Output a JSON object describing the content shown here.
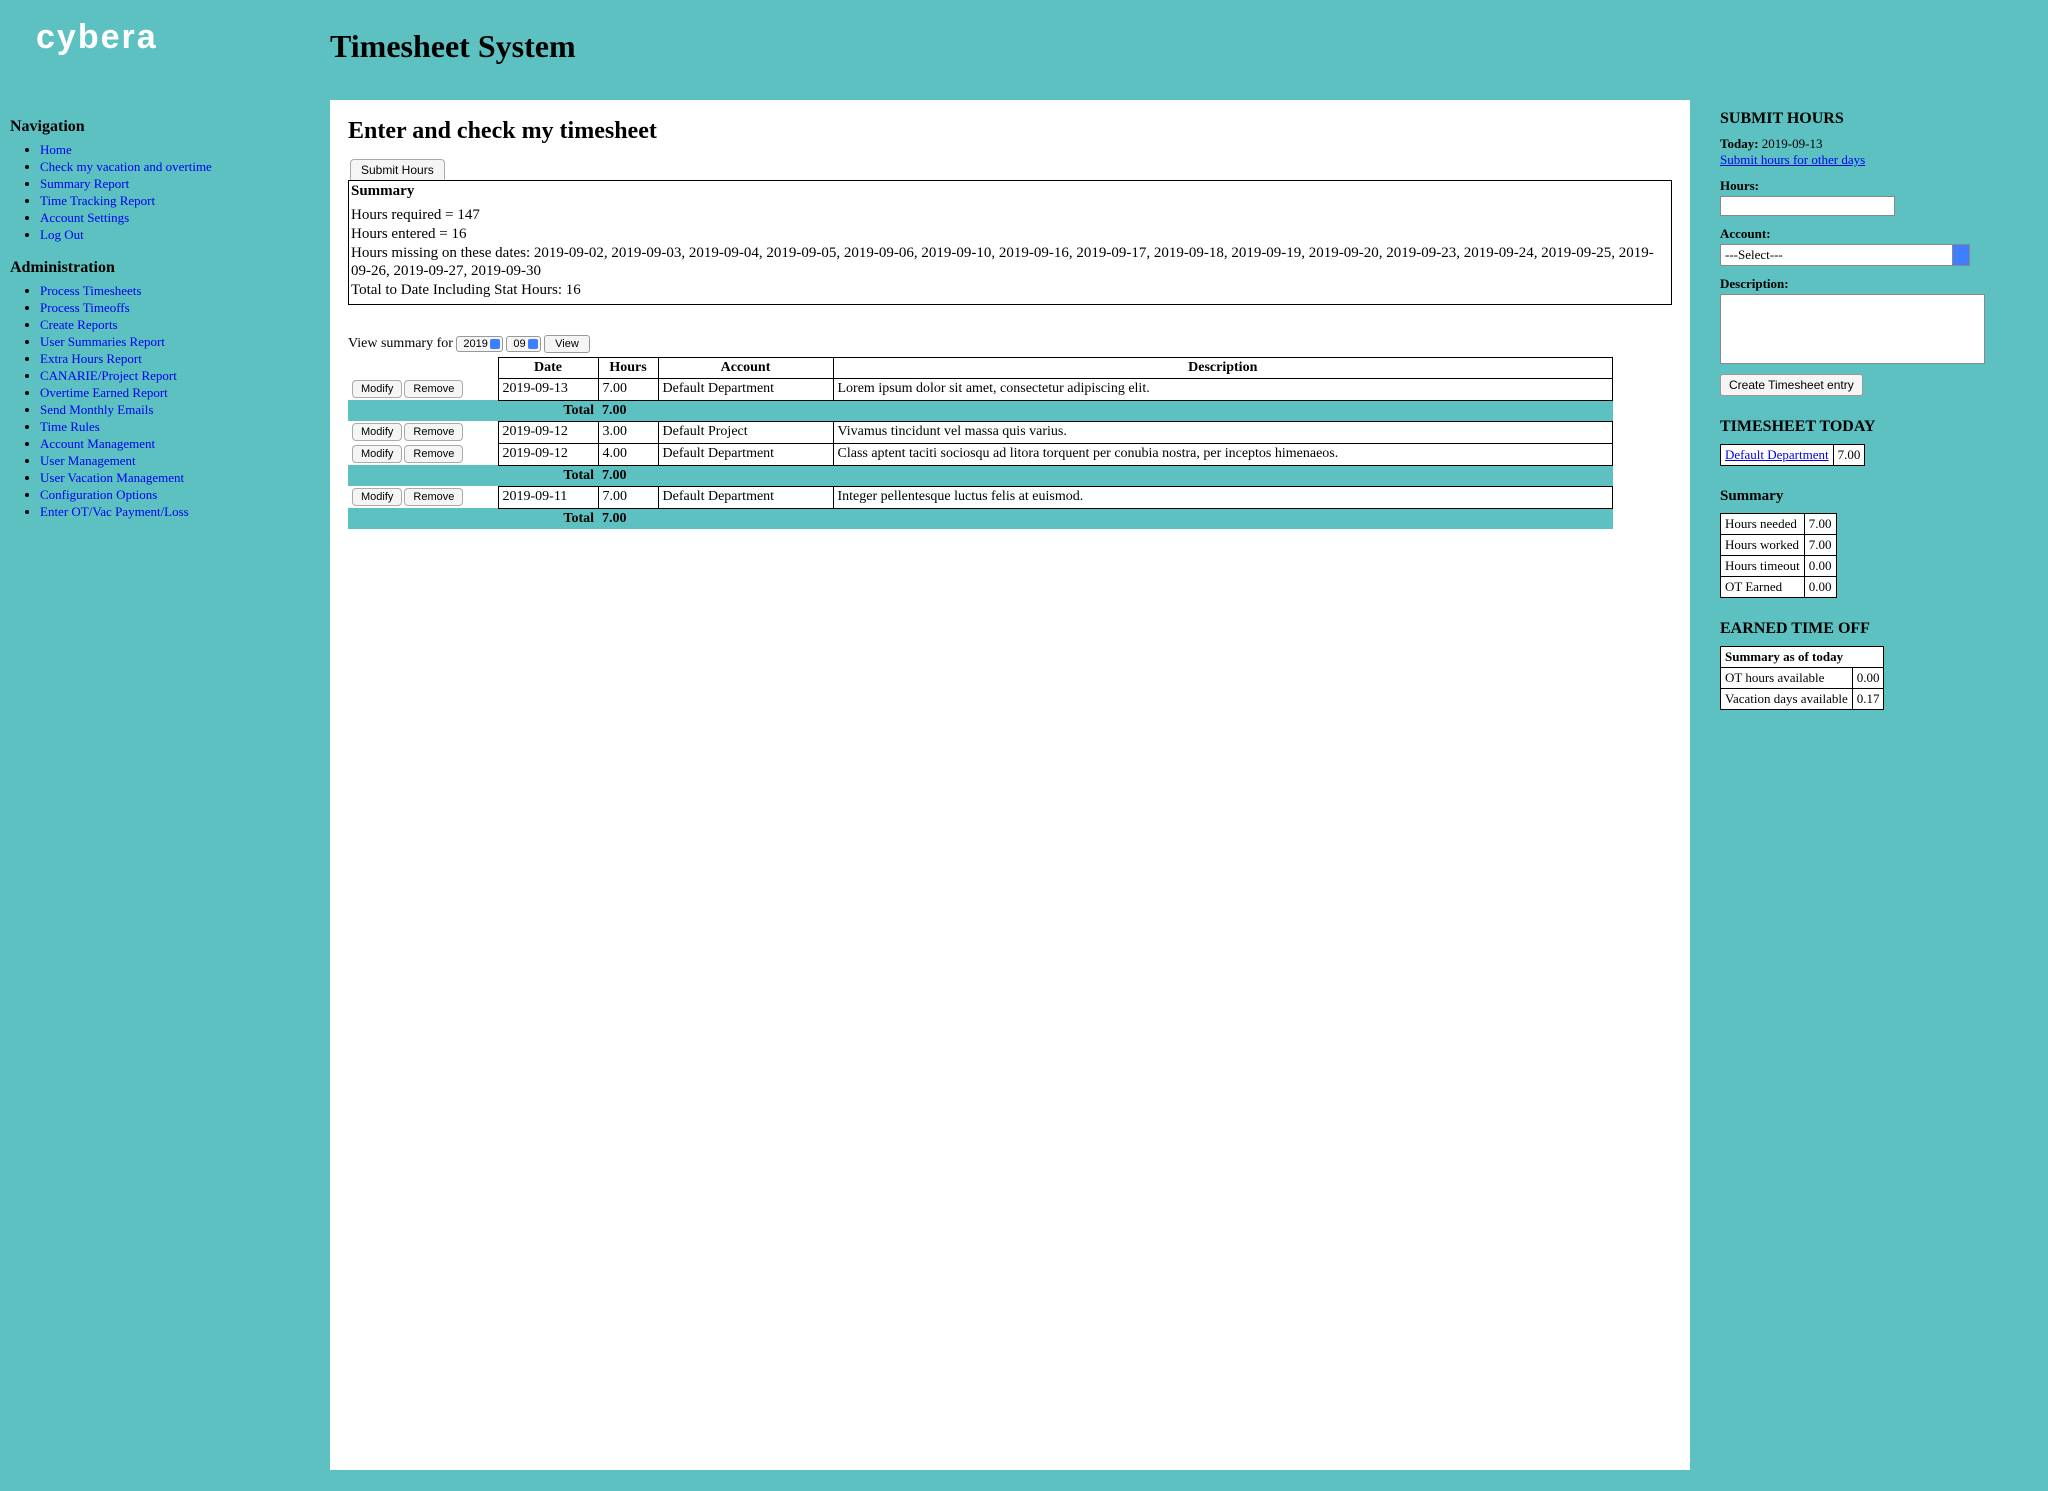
{
  "brand": "cybera",
  "app_title": "Timesheet System",
  "nav": {
    "heading": "Navigation",
    "items": [
      "Home",
      "Check my vacation and overtime",
      "Summary Report",
      "Time Tracking Report",
      "Account Settings",
      "Log Out"
    ]
  },
  "admin": {
    "heading": "Administration",
    "items": [
      "Process Timesheets",
      "Process Timeoffs",
      "Create Reports",
      "User Summaries Report",
      "Extra Hours Report",
      "CANARIE/Project Report",
      "Overtime Earned Report",
      "Send Monthly Emails",
      "Time Rules",
      "Account Management",
      "User Management",
      "User Vacation Management",
      "Configuration Options",
      "Enter OT/Vac Payment/Loss"
    ]
  },
  "main": {
    "heading": "Enter and check my timesheet",
    "tab_submit": "Submit Hours",
    "summary": {
      "title": "Summary",
      "required": "Hours required = 147",
      "entered": "Hours entered = 16",
      "missing": "Hours missing on these dates: 2019-09-02, 2019-09-03, 2019-09-04, 2019-09-05, 2019-09-06, 2019-09-10, 2019-09-16, 2019-09-17, 2019-09-18, 2019-09-19, 2019-09-20, 2019-09-23, 2019-09-24, 2019-09-25, 2019-09-26, 2019-09-27, 2019-09-30",
      "total": "Total to Date Including Stat Hours: 16"
    },
    "view_label": "View summary for",
    "year": "2019",
    "month": "09",
    "view_btn": "View",
    "modify_label": "Modify",
    "remove_label": "Remove",
    "cols": {
      "date": "Date",
      "hours": "Hours",
      "account": "Account",
      "description": "Description"
    },
    "total_label": "Total",
    "groups": [
      {
        "rows": [
          {
            "date": "2019-09-13",
            "hours": "7.00",
            "account": "Default Department",
            "desc": "Lorem ipsum dolor sit amet, consectetur adipiscing elit."
          }
        ],
        "total": "7.00"
      },
      {
        "rows": [
          {
            "date": "2019-09-12",
            "hours": "3.00",
            "account": "Default Project",
            "desc": "Vivamus tincidunt vel massa quis varius."
          },
          {
            "date": "2019-09-12",
            "hours": "4.00",
            "account": "Default Department",
            "desc": "Class aptent taciti sociosqu ad litora torquent per conubia nostra, per inceptos himenaeos."
          }
        ],
        "total": "7.00"
      },
      {
        "rows": [
          {
            "date": "2019-09-11",
            "hours": "7.00",
            "account": "Default Department",
            "desc": "Integer pellentesque luctus felis at euismod."
          }
        ],
        "total": "7.00"
      }
    ]
  },
  "right": {
    "submit_heading": "SUBMIT HOURS",
    "today_label": "Today:",
    "today_value": "2019-09-13",
    "other_days_link": "Submit hours for other days",
    "hours_label": "Hours:",
    "account_label": "Account:",
    "account_selected": "---Select---",
    "desc_label": "Description:",
    "create_btn": "Create Timesheet entry",
    "today_heading": "TIMESHEET TODAY",
    "today_entry": {
      "account": "Default Department",
      "hours": "7.00"
    },
    "summary_heading": "Summary",
    "summary_rows": [
      {
        "label": "Hours needed",
        "value": "7.00"
      },
      {
        "label": "Hours worked",
        "value": "7.00"
      },
      {
        "label": "Hours timeout",
        "value": "0.00"
      },
      {
        "label": "OT Earned",
        "value": "0.00"
      }
    ],
    "eto_heading": "EARNED TIME OFF",
    "eto_title": "Summary as of today",
    "eto_rows": [
      {
        "label": "OT hours available",
        "value": "0.00"
      },
      {
        "label": "Vacation days available",
        "value": "0.17"
      }
    ]
  }
}
